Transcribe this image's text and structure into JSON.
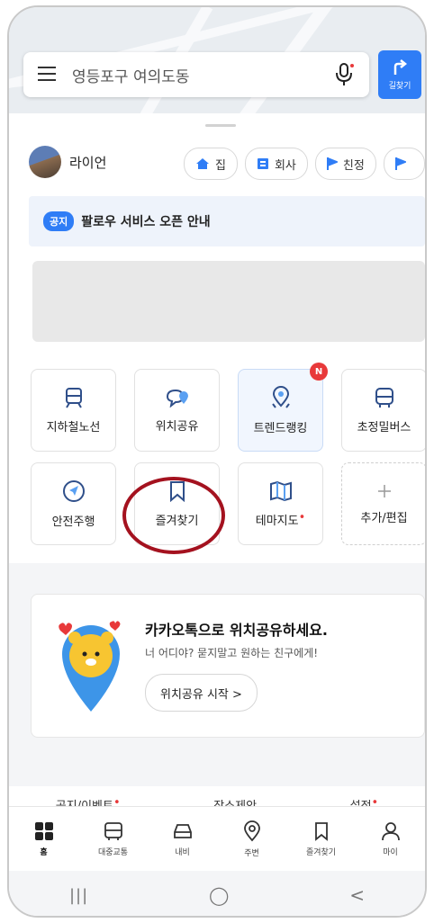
{
  "search": {
    "location": "영등포구 여의도동",
    "route_label": "길찾기"
  },
  "profile": {
    "name": "라이언"
  },
  "quick_places": [
    {
      "label": "집",
      "icon": "home-icon"
    },
    {
      "label": "회사",
      "icon": "company-icon"
    },
    {
      "label": "친정",
      "icon": "flag-icon"
    }
  ],
  "notice": {
    "badge": "공지",
    "text": "팔로우 서비스 오픈 안내"
  },
  "menu_tiles": [
    {
      "label": "지하철노선",
      "icon": "subway-icon"
    },
    {
      "label": "위치공유",
      "icon": "location-share-icon"
    },
    {
      "label": "트렌드랭킹",
      "icon": "trend-pin-icon",
      "badge": "N"
    },
    {
      "label": "초정밀버스",
      "icon": "bus-icon"
    },
    {
      "label": "안전주행",
      "icon": "navigation-arrow-icon"
    },
    {
      "label": "즐겨찾기",
      "icon": "bookmark-icon"
    },
    {
      "label": "테마지도",
      "icon": "theme-map-icon",
      "new_dot": "•"
    },
    {
      "label": "추가/편집",
      "icon": "plus-icon"
    }
  ],
  "promo": {
    "title": "카카오톡으로 위치공유하세요.",
    "subtitle": "너 어디야? 묻지말고 원하는 친구에게!",
    "button": "위치공유 시작 >"
  },
  "footer_links": [
    {
      "label": "공지/이벤트",
      "dot": "•"
    },
    {
      "label": "장소제안"
    },
    {
      "label": "설정",
      "dot": "•"
    }
  ],
  "tabs": [
    {
      "label": "홈",
      "icon": "home-grid-icon"
    },
    {
      "label": "대중교통",
      "icon": "bus-icon"
    },
    {
      "label": "내비",
      "icon": "car-icon"
    },
    {
      "label": "주변",
      "icon": "pin-icon"
    },
    {
      "label": "즐겨찾기",
      "icon": "bookmark-icon"
    },
    {
      "label": "마이",
      "icon": "person-icon"
    }
  ],
  "system_nav": [
    "|||",
    "◯",
    "<"
  ],
  "colors": {
    "accent": "#2f7df6",
    "badge_red": "#e8393a",
    "highlight_circle": "#a4121f"
  }
}
